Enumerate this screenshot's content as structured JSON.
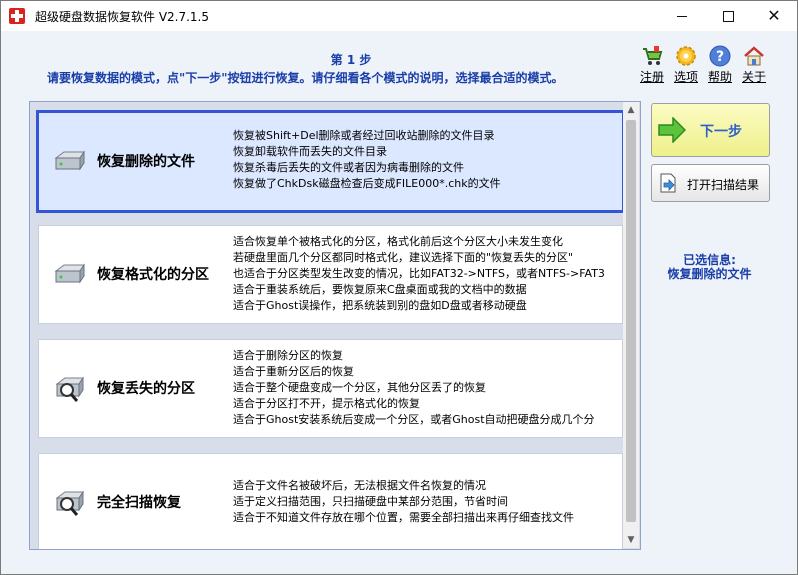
{
  "window": {
    "title": "超级硬盘数据恢复软件 V2.7.1.5"
  },
  "header": {
    "step": "第 1 步",
    "instruction": "请要恢复数据的模式，点\"下一步\"按钮进行恢复。请仔细看各个模式的说明，选择最合适的模式。"
  },
  "toolbar": [
    {
      "label": "注册",
      "icon": "cart-icon"
    },
    {
      "label": "选项",
      "icon": "gear-icon"
    },
    {
      "label": "帮助",
      "icon": "help-icon"
    },
    {
      "label": "关于",
      "icon": "home-icon"
    }
  ],
  "modes": [
    {
      "name": "恢复删除的文件",
      "selected": true,
      "icon": "harddisk-icon",
      "desc": [
        "恢复被Shift+Del删除或者经过回收站删除的文件目录",
        "恢复卸载软件而丢失的文件目录",
        "恢复杀毒后丢失的文件或者因为病毒删除的文件",
        "恢复做了ChkDsk磁盘检查后变成FILE000*.chk的文件"
      ]
    },
    {
      "name": "恢复格式化的分区",
      "selected": false,
      "icon": "harddisk-icon",
      "desc": [
        "适合恢复单个被格式化的分区，格式化前后这个分区大小未发生变化",
        "若硬盘里面几个分区都同时格式化，建议选择下面的\"恢复丢失的分区\"",
        "也适合于分区类型发生改变的情况，比如FAT32->NTFS，或者NTFS->FAT3",
        "适合于重装系统后，要恢复原来C盘桌面或我的文档中的数据",
        "适合于Ghost误操作，把系统装到别的盘如D盘或者移动硬盘"
      ]
    },
    {
      "name": "恢复丢失的分区",
      "selected": false,
      "icon": "disk-magnifier-icon",
      "desc": [
        "适合于删除分区的恢复",
        "适合于重新分区后的恢复",
        "适合于整个硬盘变成一个分区，其他分区丢了的恢复",
        "适合于分区打不开，提示格式化的恢复",
        "适合于Ghost安装系统后变成一个分区，或者Ghost自动把硬盘分成几个分"
      ]
    },
    {
      "name": "完全扫描恢复",
      "selected": false,
      "icon": "disk-magnifier-icon",
      "desc": [
        "适合于文件名被破坏后，无法根据文件名恢复的情况",
        "适于定义扫描范围，只扫描硬盘中某部分范围，节省时间",
        "适合于不知道文件存放在哪个位置，需要全部扫描出来再仔细查找文件"
      ]
    }
  ],
  "buttons": {
    "next": "下一步",
    "open_scan": "打开扫描结果"
  },
  "info": {
    "label": "已选信息:",
    "value": "恢复删除的文件"
  },
  "colors": {
    "accent": "#3355d6",
    "header_text": "#1a3ea8",
    "next_bg": "#eef08a"
  }
}
